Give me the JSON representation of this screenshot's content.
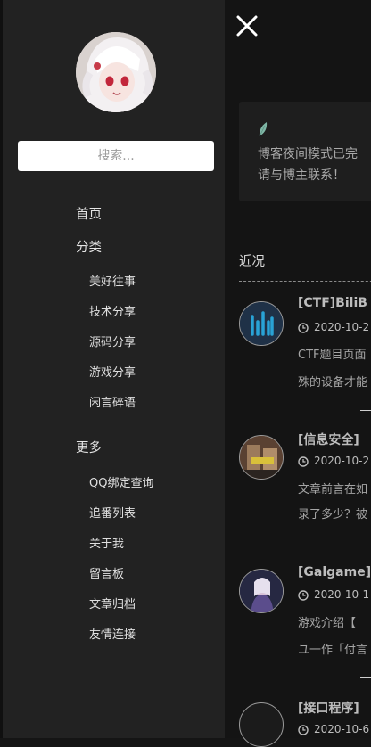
{
  "search": {
    "placeholder": "搜索..."
  },
  "nav": {
    "home": "首页",
    "categories": {
      "label": "分类",
      "items": [
        "美好往事",
        "技术分享",
        "源码分享",
        "游戏分享",
        "闲言碎语"
      ]
    },
    "more": {
      "label": "更多",
      "items": [
        "QQ绑定查询",
        "追番列表",
        "关于我",
        "留言板",
        "文章归档",
        "友情连接"
      ]
    }
  },
  "notice": {
    "line1": "博客夜间模式已完",
    "line2": "请与博主联系！"
  },
  "recent": {
    "title": "近况",
    "posts": [
      {
        "title": "[CTF]BiliB",
        "date": "2020-10-2",
        "excerpt1": "CTF题目页面",
        "excerpt2": "殊的设备才能"
      },
      {
        "title": "[信息安全]",
        "date": "2020-10-2",
        "excerpt1": "文章前言在如",
        "excerpt2": "录了多少？被"
      },
      {
        "title": "[Galgame]",
        "date": "2020-10-1",
        "excerpt1": "游戏介绍【",
        "excerpt2": "ユ一作「付言"
      },
      {
        "title": "[接口程序]",
        "date": "2020-10-6",
        "excerpt1": "",
        "excerpt2": ""
      }
    ]
  },
  "colors": {
    "drawer_bg": "#222222",
    "page_bg": "#141414",
    "accent_leaf": "#7fb7a6"
  },
  "icons": {
    "close": "close-icon",
    "clock": "clock-icon",
    "leaf": "leaf-icon"
  }
}
